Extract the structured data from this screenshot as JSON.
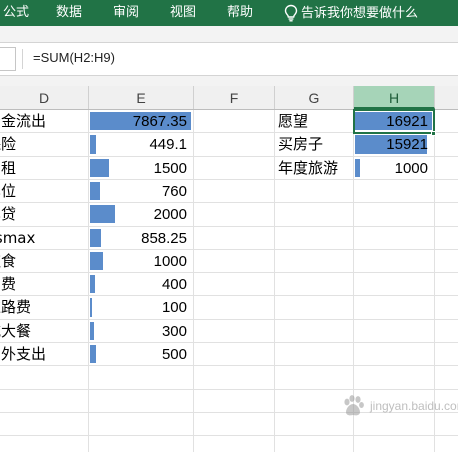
{
  "ribbon": {
    "tabs": [
      "公式",
      "数据",
      "审阅",
      "视图",
      "帮助"
    ],
    "tell_me": "告诉我你想要做什么",
    "lightbulb_icon": "lightbulb-icon"
  },
  "formula_bar": {
    "formula": "=SUM(H2:H9)"
  },
  "columns": [
    "D",
    "E",
    "F",
    "G",
    "H"
  ],
  "selected_column": "H",
  "selected_cell": "H2",
  "databar_color": "#5b8ccb",
  "accent_color": "#217346",
  "expenses": [
    {
      "label": "资金流出",
      "value": "7867.35",
      "bar_fraction": 1.0
    },
    {
      "label": "保险",
      "value": "449.1",
      "bar_fraction": 0.06
    },
    {
      "label": "房租",
      "value": "1500",
      "bar_fraction": 0.19
    },
    {
      "label": "车位",
      "value": "760",
      "bar_fraction": 0.1
    },
    {
      "label": "车贷",
      "value": "2000",
      "bar_fraction": 0.25
    },
    {
      "label": "xsmax",
      "value": "858.25",
      "bar_fraction": 0.11
    },
    {
      "label": "饮食",
      "value": "1000",
      "bar_fraction": 0.13
    },
    {
      "label": "油费",
      "value": "400",
      "bar_fraction": 0.05
    },
    {
      "label": "过路费",
      "value": "100",
      "bar_fraction": 0.013
    },
    {
      "label": "吃大餐",
      "value": "300",
      "bar_fraction": 0.04
    },
    {
      "label": "意外支出",
      "value": "500",
      "bar_fraction": 0.06
    }
  ],
  "wishes": [
    {
      "label": "愿望",
      "value": "16921",
      "bar_fraction": 1.0
    },
    {
      "label": "买房子",
      "value": "15921",
      "bar_fraction": 0.94
    },
    {
      "label": "年度旅游",
      "value": "1000",
      "bar_fraction": 0.06
    }
  ],
  "watermark": {
    "text": "jingyan.baidu.com",
    "icon": "baidu-paw-icon"
  }
}
